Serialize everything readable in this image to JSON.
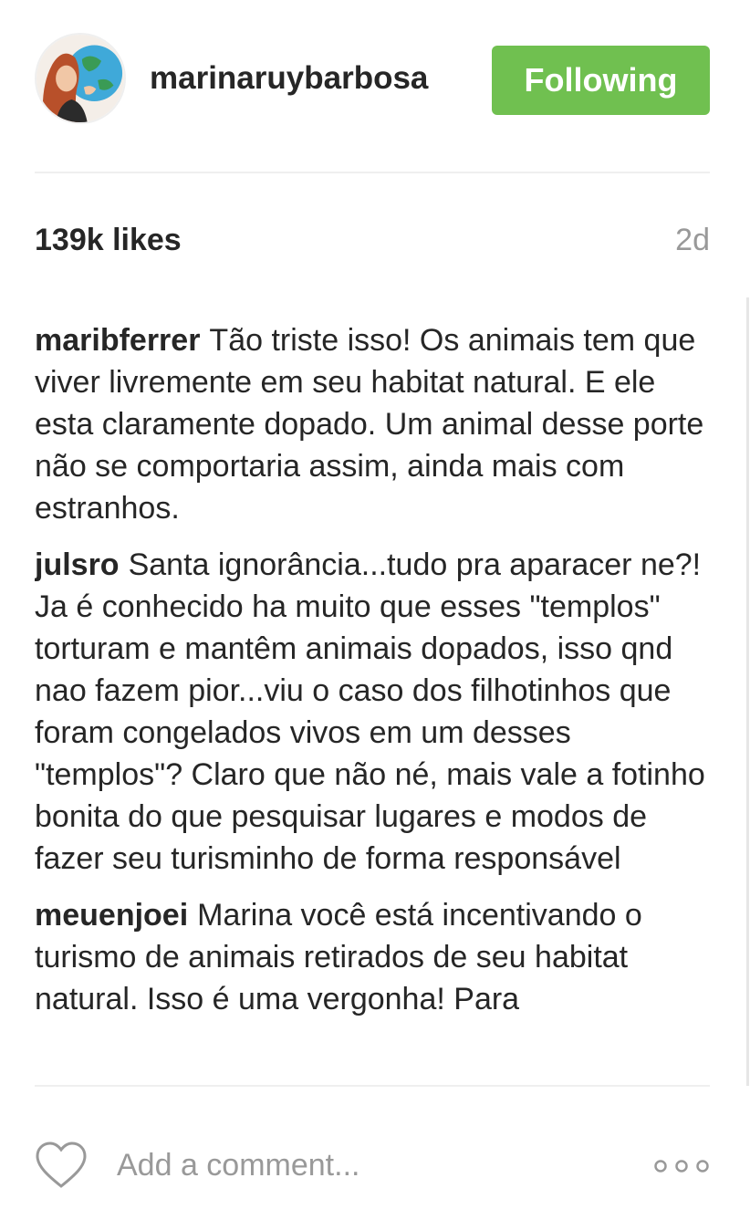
{
  "header": {
    "username": "marinaruybarbosa",
    "follow_label": "Following",
    "follow_color": "#70c050",
    "avatar_icon": "profile-avatar"
  },
  "stats": {
    "likes": "139k likes",
    "time": "2d"
  },
  "comments": [
    {
      "author": "maribferrer",
      "text": "Tão triste isso! Os animais tem que viver livremente em seu habitat natural. E ele esta claramente dopado. Um animal desse porte não se comportaria assim, ainda mais com estranhos."
    },
    {
      "author": "julsro",
      "text": "Santa ignorância...tudo pra aparacer ne?! Ja é conhecido ha muito que esses \"templos\" torturam e mantêm animais dopados, isso qnd nao fazem pior...viu o caso dos filhotinhos que foram congelados vivos em um desses \"templos\"? Claro que não né, mais vale a fotinho bonita do que pesquisar lugares e modos de fazer seu turisminho de forma responsável"
    },
    {
      "author": "meuenjoei",
      "text": "Marina você está incentivando o turismo de animais retirados de seu habitat natural. Isso é uma vergonha! Para"
    }
  ],
  "footer": {
    "comment_placeholder": "Add a comment...",
    "like_icon": "heart-icon",
    "more_icon": "more-options-icon"
  }
}
